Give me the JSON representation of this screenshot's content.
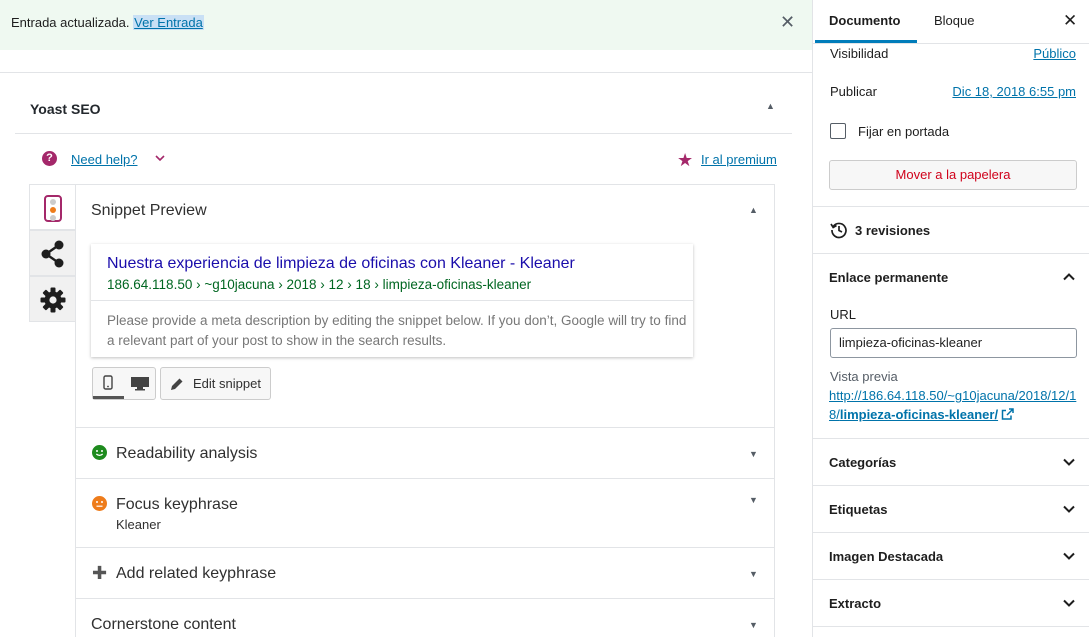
{
  "notice": {
    "message": "Entrada actualizada.",
    "link_label": "Ver Entrada"
  },
  "yoast": {
    "title": "Yoast SEO",
    "help_label": "Need help?",
    "premium_label": "Ir al premium"
  },
  "panel": {
    "snippet": {
      "heading": "Snippet Preview",
      "title": "Nuestra experiencia de limpieza de oficinas con Kleaner - Kleaner",
      "url": "186.64.118.50 › ~g10jacuna › 2018 › 12 › 18 › limpieza-oficinas-kleaner",
      "description": "Please provide a meta description by editing the snippet below. If you don’t, Google will try to find a relevant part of your post to show in the search results.",
      "edit_label": "Edit snippet"
    },
    "readability": "Readability analysis",
    "focus": {
      "heading": "Focus keyphrase",
      "value": "Kleaner"
    },
    "related": "Add related keyphrase",
    "cornerstone": "Cornerstone content"
  },
  "sidebar": {
    "tabs": [
      "Documento",
      "Bloque"
    ],
    "visibility": {
      "label": "Visibilidad",
      "value": "Público"
    },
    "publish": {
      "label": "Publicar",
      "value": "Dic 18, 2018 6:55 pm"
    },
    "sticky_label": "Fijar en portada",
    "trash_label": "Mover a la papelera",
    "revisions": "3 revisiones",
    "permalink": {
      "heading": "Enlace permanente",
      "url_label": "URL",
      "slug": "limpieza-oficinas-kleaner",
      "preview_label": "Vista previa",
      "preview_base": "http://186.64.118.50/~g10jacuna/2018/12/18/",
      "preview_slug": "limpieza-oficinas-kleaner/"
    },
    "panels": [
      "Categorías",
      "Etiquetas",
      "Imagen Destacada",
      "Extracto"
    ]
  },
  "colors": {
    "accent": "#007cba",
    "yoast_brand": "#a4286a",
    "notice_bg": "#eff9f1",
    "good": "#1e8b1e",
    "ok": "#ee7c1b",
    "danger": "#d0021b"
  }
}
